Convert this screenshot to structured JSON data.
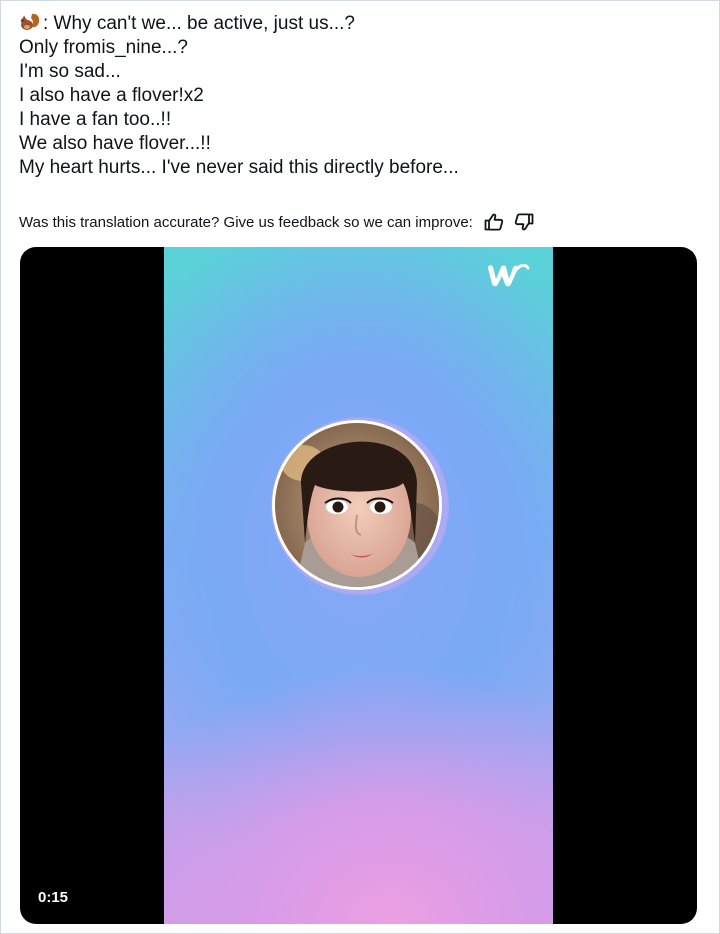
{
  "tweet": {
    "lines": [
      ": Why can't we... be active, just us...?",
      "Only fromis_nine...?",
      "I'm so sad...",
      "I also have a flover!x2",
      "I have a fan too..!!",
      "We also have flover...!!",
      "My heart hurts... I've never said this directly before..."
    ],
    "leading_emoji_icon": "squirrel-icon"
  },
  "translation_feedback": {
    "prompt": "Was this translation accurate? Give us feedback so we can improve:",
    "thumbs_up_icon": "thumbs-up-icon",
    "thumbs_down_icon": "thumbs-down-icon"
  },
  "media": {
    "timestamp": "0:15",
    "watermark_icon": "weverse-logo-icon",
    "colors": {
      "letterbox": "#000000",
      "gradient_top": "#5ad3d8",
      "gradient_mid": "#86a8f6",
      "gradient_bottom": "#ec9ee2"
    }
  }
}
